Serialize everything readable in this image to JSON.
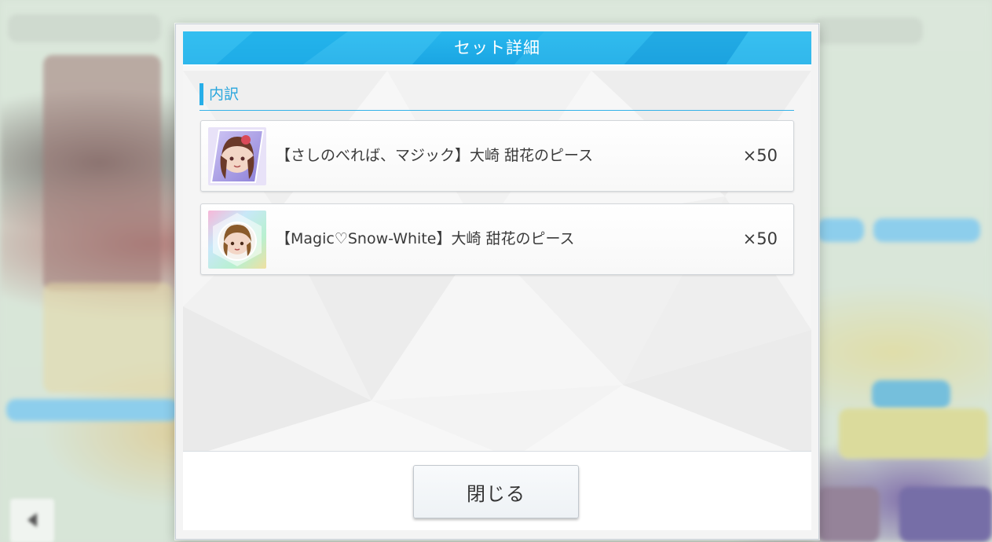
{
  "dialog": {
    "title": "セット詳細",
    "section_label": "内訳",
    "items": [
      {
        "name": "【さしのべれば、マジック】大崎 甜花のピース",
        "quantity": "×50",
        "thumb_icon": "character-piece-icon",
        "thumb_style": "purple"
      },
      {
        "name": "【Magic♡Snow-White】大崎 甜花のピース",
        "quantity": "×50",
        "thumb_icon": "character-piece-icon",
        "thumb_style": "rainbow"
      }
    ],
    "close_label": "閉じる"
  },
  "colors": {
    "title_bar": "#1aa4e2",
    "accent": "#27aee8",
    "text": "#3a3a3a"
  }
}
